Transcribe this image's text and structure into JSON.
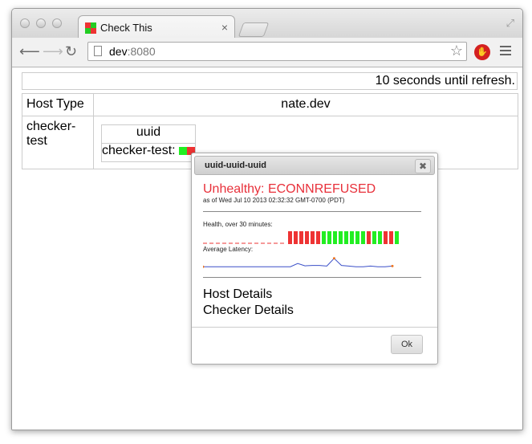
{
  "browser": {
    "tab_title": "Check This",
    "tab_close": "×",
    "url_host": "dev",
    "url_port": ":8080",
    "star_icon": "☆",
    "stop_label": "✋"
  },
  "page": {
    "refresh_text": "10 seconds until refresh.",
    "table": {
      "header_host_type": "Host Type",
      "header_host": "nate.dev",
      "row_label": "checker-\ntest",
      "inner_header": "uuid",
      "inner_cell": "checker-test:"
    }
  },
  "dialog": {
    "title": "uuid-uuid-uuid",
    "close": "✖",
    "status": "Unhealthy: ECONNREFUSED",
    "as_of": "as of Wed Jul 10 2013 02:32:32 GMT-0700 (PDT)",
    "health_label": "Health, over 30 minutes:",
    "latency_label": "Average Latency:",
    "link_host_details": "Host Details",
    "link_checker_details": "Checker Details",
    "ok": "Ok",
    "health_bars": [
      "red",
      "red",
      "red",
      "red",
      "red",
      "red",
      "green",
      "green",
      "green",
      "green",
      "green",
      "green",
      "green",
      "green",
      "red",
      "green",
      "green",
      "red",
      "red",
      "green"
    ],
    "latency": [
      0.05,
      0.05,
      0.05,
      0.05,
      0.05,
      0.05,
      0.05,
      0.05,
      0.05,
      0.05,
      0.05,
      0.05,
      0.05,
      0.3,
      0.12,
      0.15,
      0.15,
      0.1,
      0.7,
      0.15,
      0.1,
      0.05,
      0.05,
      0.1,
      0.05,
      0.05,
      0.1
    ]
  },
  "colors": {
    "healthy": "#22ee22",
    "unhealthy": "#ee3333",
    "latency_line": "#3a4fc8",
    "status_text": "#e8303a"
  }
}
